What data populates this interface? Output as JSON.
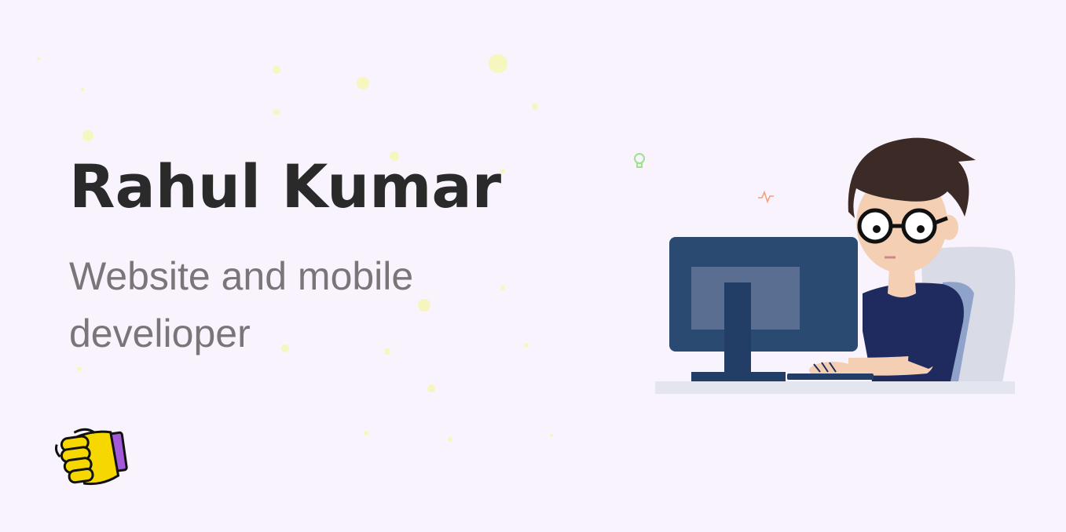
{
  "hero": {
    "name": "Rahul Kumar",
    "role": "Website and mobile develioper"
  },
  "colors": {
    "background": "#f8f3fc",
    "name_text": "#2a2a2a",
    "role_text": "#7b7479",
    "monitor": "#233e66",
    "shirt": "#1f2b5e",
    "fist": "#f6d800",
    "sleeve": "#a35ad8"
  },
  "icons": {
    "fist": "raised-fist-icon",
    "bulb": "lightbulb-icon",
    "pulse": "heartbeat-icon"
  }
}
